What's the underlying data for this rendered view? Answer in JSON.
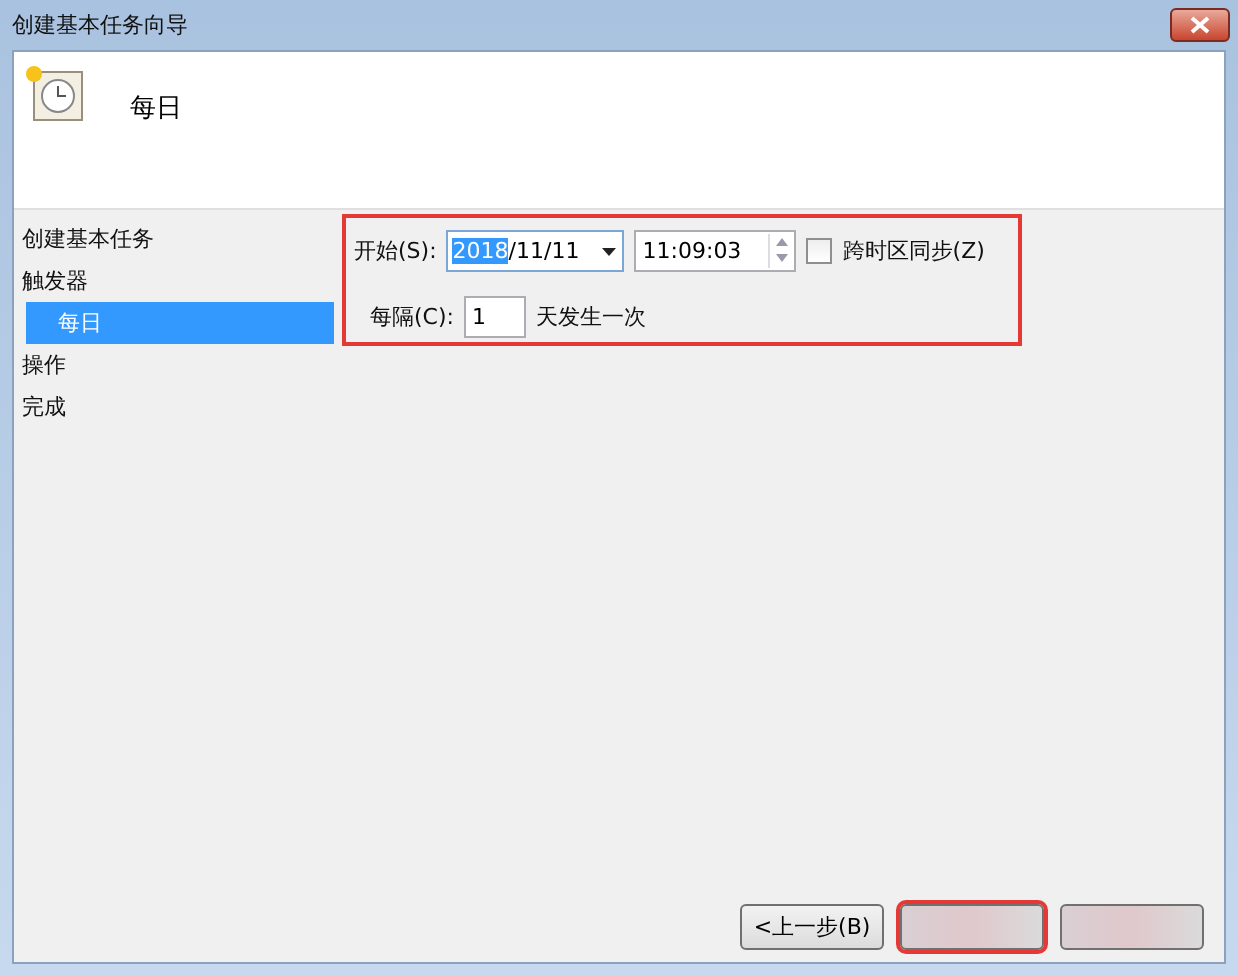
{
  "window": {
    "title": "创建基本任务向导"
  },
  "header": {
    "title": "每日"
  },
  "sidebar": {
    "items": [
      {
        "label": "创建基本任务",
        "selected": false
      },
      {
        "label": "触发器",
        "selected": false,
        "children": [
          {
            "label": "每日",
            "selected": true
          }
        ]
      },
      {
        "label": "操作",
        "selected": false
      },
      {
        "label": "完成",
        "selected": false
      }
    ]
  },
  "form": {
    "start_label": "开始(S):",
    "date": {
      "selected_text": "2018",
      "text": "/11/11"
    },
    "time": "11:09:03",
    "sync": {
      "label": "跨时区同步(Z)",
      "checked": false
    },
    "every_label": "每隔(C):",
    "every_value": "1",
    "every_suffix": "天发生一次",
    "highlighted": true
  },
  "buttons": [
    {
      "kind": "text",
      "label": "<上一步(B)"
    },
    {
      "kind": "blurred",
      "highlighted": true
    },
    {
      "kind": "blurred",
      "highlighted": false
    }
  ]
}
